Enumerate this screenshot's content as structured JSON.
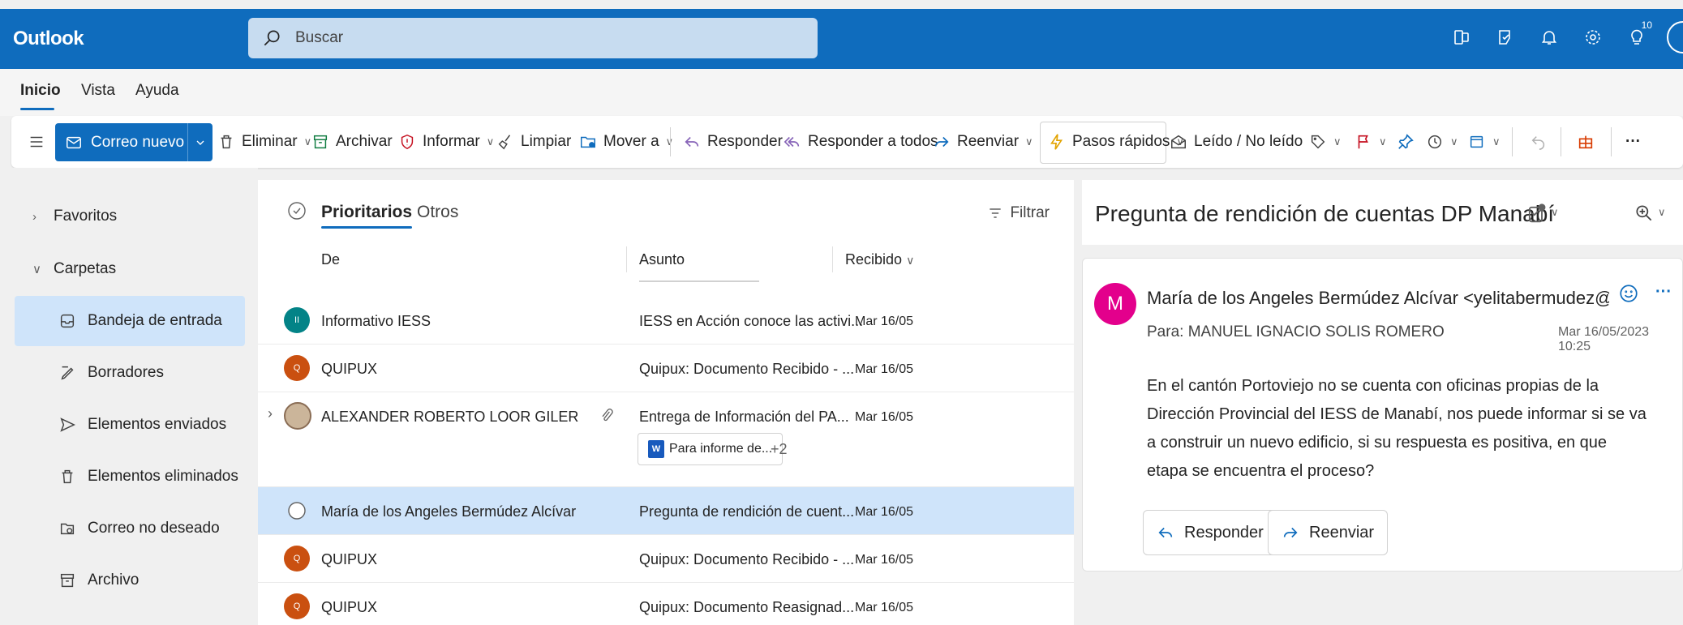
{
  "app": {
    "name": "Outlook"
  },
  "search": {
    "placeholder": "Buscar"
  },
  "top_icons": [
    {
      "name": "office-apps-icon"
    },
    {
      "name": "teams-icon"
    },
    {
      "name": "bell-icon"
    },
    {
      "name": "gear-icon"
    },
    {
      "name": "tips-icon",
      "badge": "10"
    }
  ],
  "menu": {
    "tabs": [
      "Inicio",
      "Vista",
      "Ayuda"
    ],
    "active": "Inicio"
  },
  "ribbon": {
    "new_mail": "Correo nuevo",
    "delete": "Eliminar",
    "archive": "Archivar",
    "report": "Informar",
    "sweep": "Limpiar",
    "move": "Mover a",
    "reply": "Responder",
    "reply_all": "Responder a todos",
    "forward": "Reenviar",
    "quick_steps": "Pasos rápidos",
    "read_unread": "Leído / No leído",
    "more": "···"
  },
  "sidebar": {
    "favorites": "Favoritos",
    "folders": "Carpetas",
    "items": [
      {
        "label": "Bandeja de entrada",
        "icon": "inbox-icon",
        "selected": true
      },
      {
        "label": "Borradores",
        "icon": "draft-icon"
      },
      {
        "label": "Elementos enviados",
        "icon": "send-icon"
      },
      {
        "label": "Elementos eliminados",
        "icon": "trash-icon"
      },
      {
        "label": "Correo no deseado",
        "icon": "junk-icon"
      },
      {
        "label": "Archivo",
        "icon": "archive-icon"
      }
    ]
  },
  "list": {
    "pivots": [
      "Prioritarios",
      "Otros"
    ],
    "filter": "Filtrar",
    "columns": {
      "from": "De",
      "subject": "Asunto",
      "received": "Recibido"
    },
    "rows": [
      {
        "from": "Informativo IESS",
        "initials": "II",
        "avatar_color": "#038387",
        "subject": "IESS en Acción conoce las activi...",
        "date": "Mar 16/05"
      },
      {
        "from": "QUIPUX",
        "initials": "Q",
        "avatar_color": "#ca5010",
        "subject": "Quipux: Documento Recibido - ...",
        "date": "Mar 16/05"
      },
      {
        "from": "ALEXANDER ROBERTO LOOR GILER",
        "initials": "",
        "avatar_color": "#6b4f3a",
        "subject": "Entrega de Información del PA...",
        "date": "Mar 16/05",
        "attachment": "Para informe de...",
        "more_attachments": "+2"
      },
      {
        "from": "María de los Angeles Bermúdez Alcívar",
        "initials": "",
        "avatar_color": "",
        "subject": "Pregunta de rendición de cuent...",
        "date": "Mar 16/05",
        "selected": true
      },
      {
        "from": "QUIPUX",
        "initials": "Q",
        "avatar_color": "#ca5010",
        "subject": "Quipux: Documento Recibido - ...",
        "date": "Mar 16/05"
      },
      {
        "from": "QUIPUX",
        "initials": "Q",
        "avatar_color": "#ca5010",
        "subject": "Quipux: Documento Reasignad...",
        "date": "Mar 16/05"
      }
    ]
  },
  "reading": {
    "subject": "Pregunta de rendición de cuentas DP Manabí",
    "sender_initial": "M",
    "sender": "María de los Angeles Bermúdez Alcívar <yelitabermudez@hotmai",
    "to_label": "Para:",
    "to": "MANUEL IGNACIO SOLIS ROMERO",
    "date": "Mar 16/05/2023 10:25",
    "body": "En el cantón Portoviejo no se cuenta con oficinas propias de la Dirección Provincial del IESS de Manabí, nos puede informar si se va a construir un nuevo edificio, si su respuesta es positiva, en que etapa se encuentra el proceso?",
    "reply": "Responder",
    "forward": "Reenviar"
  }
}
